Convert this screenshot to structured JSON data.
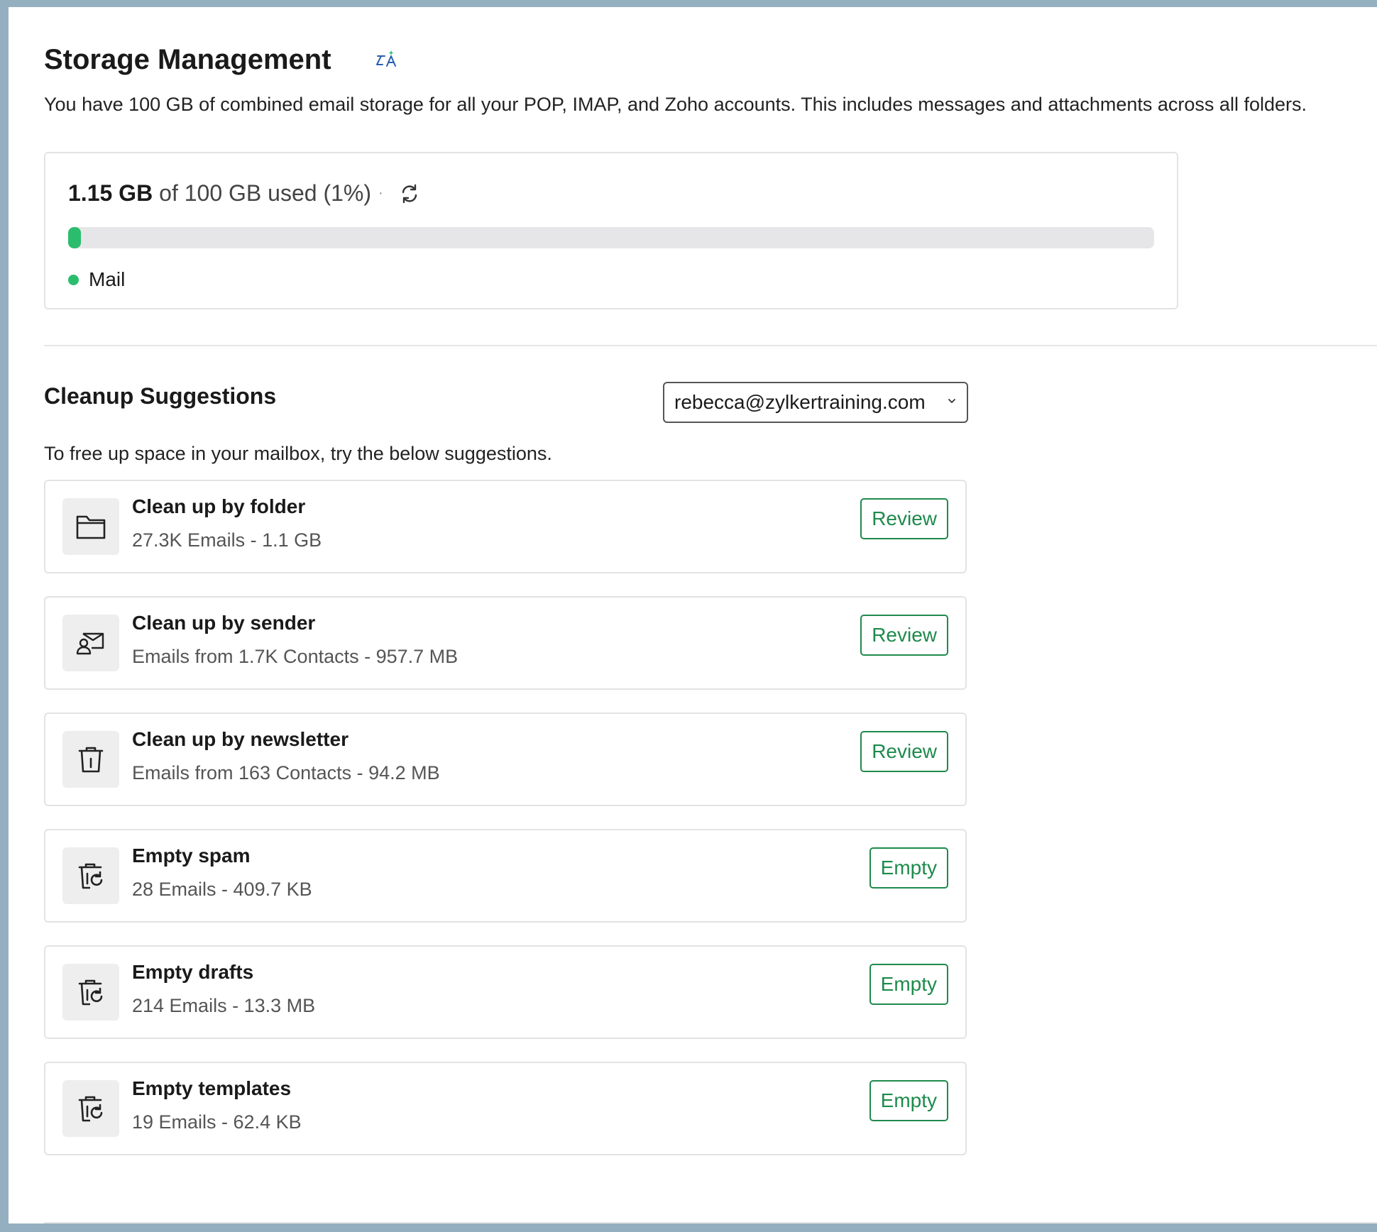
{
  "header": {
    "title": "Storage Management",
    "description": "You have 100 GB of combined email storage for all your POP, IMAP, and Zoho accounts. This includes messages and attachments across all folders."
  },
  "usage": {
    "used_label": "1.15 GB",
    "total_label": "of 100 GB used (1%)",
    "separator": "·",
    "percent_used": 1.15,
    "fill_color": "#2bbd6e",
    "legend_label": "Mail"
  },
  "cleanup": {
    "title": "Cleanup Suggestions",
    "account": "rebecca@zylkertraining.com",
    "description": "To free up space in your mailbox, try the below suggestions.",
    "items": [
      {
        "icon": "folder-icon",
        "title": "Clean up by folder",
        "subtitle": "27.3K Emails - 1.1 GB",
        "action": "Review"
      },
      {
        "icon": "sender-icon",
        "title": "Clean up by sender",
        "subtitle": "Emails from 1.7K Contacts - 957.7 MB",
        "action": "Review"
      },
      {
        "icon": "newsletter-trash-icon",
        "title": "Clean up by newsletter",
        "subtitle": "Emails from 163 Contacts - 94.2 MB",
        "action": "Review"
      },
      {
        "icon": "empty-bin-icon",
        "title": "Empty spam",
        "subtitle": "28 Emails - 409.7 KB",
        "action": "Empty"
      },
      {
        "icon": "empty-bin-icon",
        "title": "Empty drafts",
        "subtitle": "214 Emails - 13.3 MB",
        "action": "Empty"
      },
      {
        "icon": "empty-bin-icon",
        "title": "Empty templates",
        "subtitle": "19 Emails - 62.4 KB",
        "action": "Empty"
      }
    ]
  },
  "colors": {
    "accent_green": "#1e8a4c",
    "bar_green": "#2bbd6e",
    "frame": "#94b0c0"
  }
}
